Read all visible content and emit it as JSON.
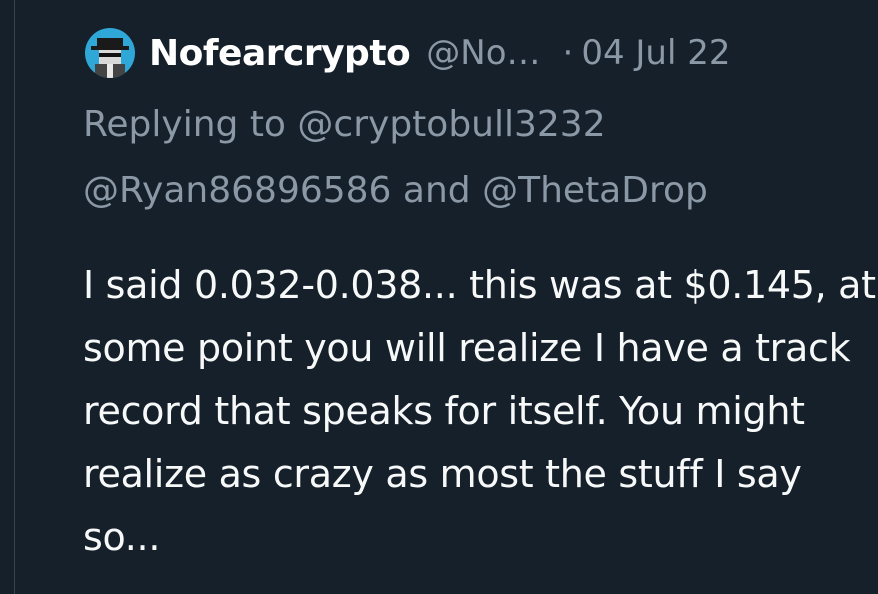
{
  "tweet": {
    "author": {
      "display_name": "Nofearcrypto",
      "handle": "@No…",
      "avatar": "pixel-art-detective-avatar"
    },
    "separator": "·",
    "date": "04 Jul 22",
    "reply": {
      "prefix": "Replying to",
      "mention_1": "@cryptobull3232",
      "mention_2": "@Ryan86896586",
      "conjunction": "and",
      "mention_3": "@ThetaDrop"
    },
    "text": "I said 0.032-0.038... this was at $0.145, at some point you will realize I have a track record that speaks for itself. You might realize as crazy as most the stuff I say so..."
  },
  "colors": {
    "background": "#15202b",
    "primary_text": "#f7f9f9",
    "secondary_text": "#8b98a5",
    "border": "#38444d",
    "avatar_bg": "#2fa8d8"
  }
}
